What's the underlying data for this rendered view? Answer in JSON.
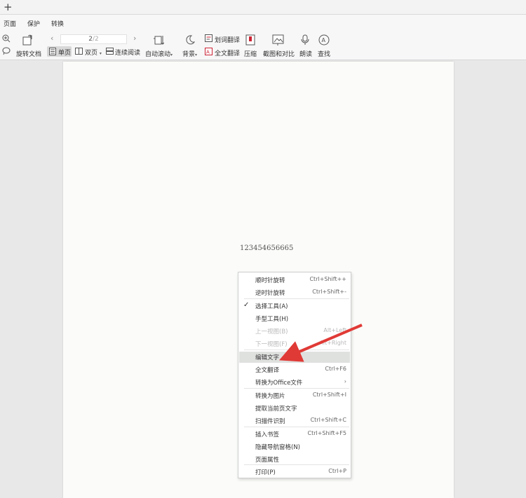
{
  "tabbar": {
    "new_tab": "+"
  },
  "menubar": {
    "items": [
      "页面",
      "保护",
      "转换"
    ]
  },
  "toolbar": {
    "rotate_doc": "旋转文档",
    "single_page": "单页",
    "double_page": "双页",
    "continuous_read": "连续阅读",
    "auto_scroll": "自动滚动",
    "background": "背景",
    "word_translate": "划词翻译",
    "full_translate": "全文翻译",
    "compress": "压缩",
    "screenshot_compare": "截图和对比",
    "read_aloud": "朗读",
    "find": "查找",
    "page_current": "2",
    "page_total": "/2",
    "caret": "▾"
  },
  "document": {
    "text": "12345465666​5"
  },
  "context_menu": {
    "items": [
      {
        "label": "顺时针旋转",
        "shortcut": "Ctrl+Shift++",
        "checked": false,
        "disabled": false,
        "highlighted": false
      },
      {
        "label": "逆时针旋转",
        "shortcut": "Ctrl+Shift+-",
        "checked": false,
        "disabled": false,
        "highlighted": false
      },
      {
        "label": "选择工具(A)",
        "shortcut": "",
        "checked": true,
        "disabled": false,
        "highlighted": false
      },
      {
        "label": "手型工具(H)",
        "shortcut": "",
        "checked": false,
        "disabled": false,
        "highlighted": false
      },
      {
        "label": "上一视图(B)",
        "shortcut": "Alt+Left",
        "checked": false,
        "disabled": true,
        "highlighted": false
      },
      {
        "label": "下一视图(F)",
        "shortcut": "Alt+Right",
        "checked": false,
        "disabled": true,
        "highlighted": false
      },
      {
        "label": "编辑文字",
        "shortcut": "",
        "checked": false,
        "disabled": false,
        "highlighted": true
      },
      {
        "label": "全文翻译",
        "shortcut": "Ctrl+F6",
        "checked": false,
        "disabled": false,
        "highlighted": false
      },
      {
        "label": "转换为Office文件",
        "shortcut": "›",
        "checked": false,
        "disabled": false,
        "highlighted": false
      },
      {
        "label": "转换为图片",
        "shortcut": "Ctrl+Shift+I",
        "checked": false,
        "disabled": false,
        "highlighted": false
      },
      {
        "label": "提取当前页文字",
        "shortcut": "",
        "checked": false,
        "disabled": false,
        "highlighted": false
      },
      {
        "label": "扫描件识别",
        "shortcut": "Ctrl+Shift+C",
        "checked": false,
        "disabled": false,
        "highlighted": false
      },
      {
        "label": "插入书签",
        "shortcut": "Ctrl+Shift+F5",
        "checked": false,
        "disabled": false,
        "highlighted": false
      },
      {
        "label": "隐藏导航窗格(N)",
        "shortcut": "",
        "checked": false,
        "disabled": false,
        "highlighted": false
      },
      {
        "label": "页面属性",
        "shortcut": "",
        "checked": false,
        "disabled": false,
        "highlighted": false
      },
      {
        "label": "打印(P)",
        "shortcut": "Ctrl+P",
        "checked": false,
        "disabled": false,
        "highlighted": false
      }
    ],
    "check_mark": "✓"
  },
  "colors": {
    "annotation_arrow": "#e03a36",
    "highlight": "#dfe1df"
  }
}
